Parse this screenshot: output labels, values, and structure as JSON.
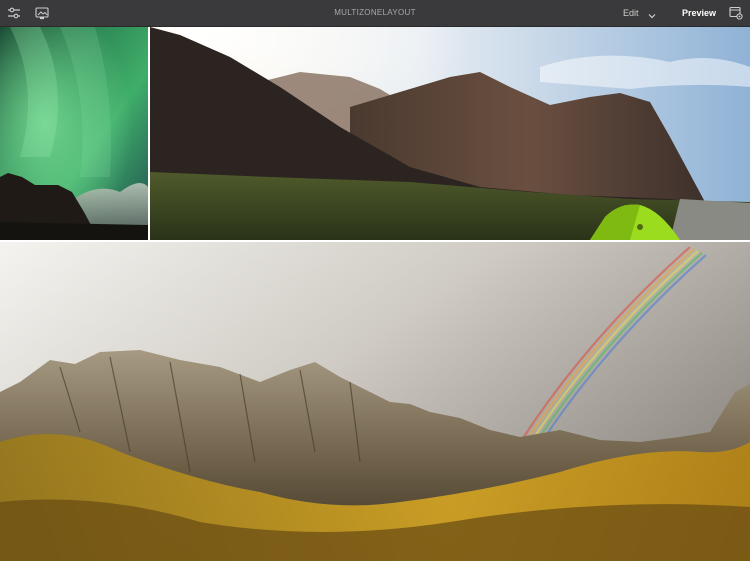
{
  "topbar": {
    "title": "MULTIZONELAYOUT",
    "edit_label": "Edit",
    "preview_label": "Preview",
    "icons": {
      "left_1": "sliders-icon",
      "left_2": "image-settings-icon",
      "right": "layout-settings-icon",
      "edit_dropdown": "chevron-down-icon"
    }
  },
  "colors": {
    "topbar_bg": "#3a3a3c",
    "title_text": "#a9a9a9",
    "preview_text": "#ffffff",
    "aurora_green": "#3fae6a",
    "tent_green": "#9bdc1e",
    "autumn_gold": "#c89a1a"
  }
}
